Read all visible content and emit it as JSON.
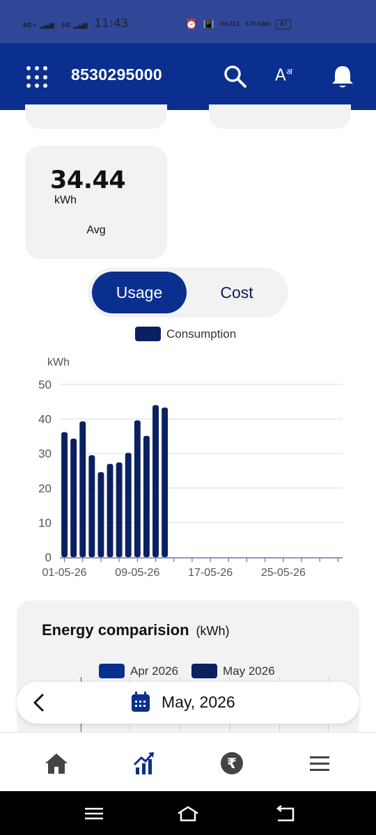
{
  "status_bar": {
    "network1": "4G+",
    "network2": "3G",
    "time": "11:43",
    "net_type": "VoLTE1",
    "speed": "5.70 KB/s",
    "battery": "67"
  },
  "header": {
    "account_number": "8530295000",
    "font_icon_label": "A",
    "font_icon_sup": "अ"
  },
  "avg_card": {
    "value": "34.44",
    "unit": "kWh",
    "label": "Avg"
  },
  "toggle": {
    "usage": "Usage",
    "cost": "Cost",
    "selected": "Usage"
  },
  "chart_data": {
    "type": "bar",
    "legend": "Consumption",
    "ylabel": "kWh",
    "ylim": [
      0,
      50
    ],
    "yticks": [
      0,
      10,
      20,
      30,
      40,
      50
    ],
    "xtick_labels": [
      "01-05-26",
      "09-05-26",
      "17-05-26",
      "25-05-26"
    ],
    "series": [
      {
        "name": "Consumption",
        "color": "#0b2060",
        "values": [
          36.2,
          34.3,
          39.3,
          29.5,
          24.6,
          27.0,
          27.4,
          30.2,
          39.6,
          35.1,
          44.0,
          43.3
        ]
      }
    ],
    "days_in_month": 31,
    "grid": true
  },
  "comparison": {
    "title": "Energy comparision",
    "unit": "(kWh)",
    "legend": [
      {
        "label": "Apr 2026",
        "color": "#0b2f8f"
      },
      {
        "label": "May 2026",
        "color": "#0b2060"
      }
    ]
  },
  "month_picker": {
    "label": "May, 2026"
  },
  "colors": {
    "primary": "#0b2f8f",
    "bar": "#0b2060",
    "card": "#f2f2f2"
  }
}
